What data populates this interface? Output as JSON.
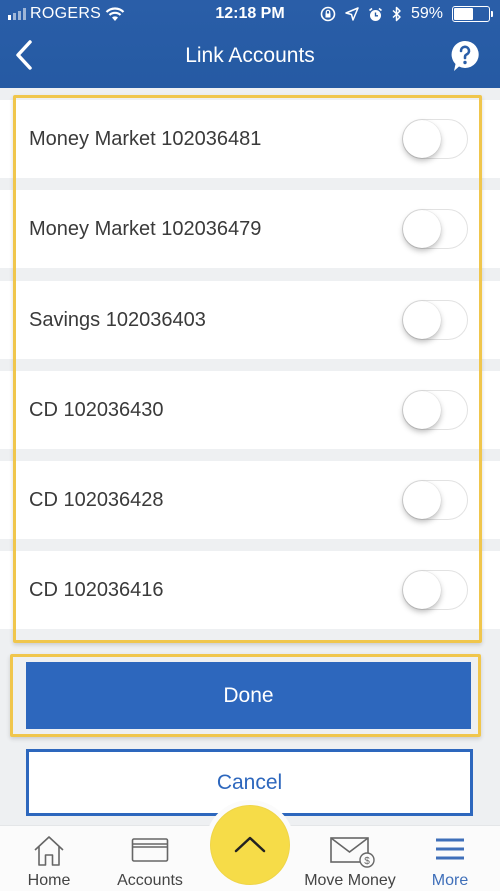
{
  "status_bar": {
    "carrier": "ROGERS",
    "time": "12:18 PM",
    "battery_percent_label": "59%",
    "battery_level": 0.59,
    "icons": [
      "signal-icon",
      "wifi-icon",
      "orientation-lock-icon",
      "location-icon",
      "alarm-icon",
      "bluetooth-icon",
      "battery-icon"
    ]
  },
  "header": {
    "title": "Link Accounts",
    "back_icon": "chevron-left-icon",
    "help_icon": "help-question-bubble-icon"
  },
  "accounts": [
    {
      "label": "Money Market 102036481",
      "linked": false
    },
    {
      "label": "Money Market 102036479",
      "linked": false
    },
    {
      "label": "Savings 102036403",
      "linked": false
    },
    {
      "label": "CD 102036430",
      "linked": false
    },
    {
      "label": "CD 102036428",
      "linked": false
    },
    {
      "label": "CD 102036416",
      "linked": false
    }
  ],
  "actions": {
    "done_label": "Done",
    "cancel_label": "Cancel"
  },
  "tabbar": {
    "items": [
      {
        "label": "Home",
        "icon": "home-icon",
        "active": false
      },
      {
        "label": "Accounts",
        "icon": "card-icon",
        "active": false
      },
      {
        "label": "Move Money",
        "icon": "envelope-dollar-icon",
        "active": false
      },
      {
        "label": "More",
        "icon": "hamburger-menu-icon",
        "active": true
      }
    ],
    "fab_icon": "chevron-up-icon"
  },
  "colors": {
    "header_blue": "#2a5ea8",
    "primary_button": "#2d67bd",
    "highlight_yellow": "#f0c64c",
    "fab_yellow": "#f6dc48",
    "active_tab": "#3f6fb9"
  }
}
